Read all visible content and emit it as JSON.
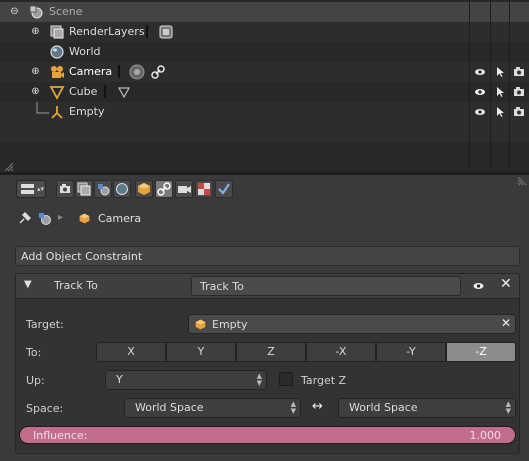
{
  "outliner": {
    "rows": [
      {
        "label": "Scene",
        "icon": "scene-icon"
      },
      {
        "label": "RenderLayers",
        "icon": "render-layers-icon"
      },
      {
        "label": "World",
        "icon": "world-icon"
      },
      {
        "label": "Camera",
        "icon": "camera-object-icon"
      },
      {
        "label": "Cube",
        "icon": "mesh-object-icon"
      },
      {
        "label": "Empty",
        "icon": "empty-object-icon"
      }
    ]
  },
  "properties": {
    "breadcrumb": {
      "object_name": "Camera"
    },
    "add_constraint_label": "Add Object Constraint",
    "constraint": {
      "type_label": "Track To",
      "name_value": "Track To",
      "target_label": "Target:",
      "target_value": "Empty",
      "to_label": "To:",
      "to_axes": [
        "X",
        "Y",
        "Z",
        "-X",
        "-Y",
        "-Z"
      ],
      "to_selected": "-Z",
      "up_label": "Up:",
      "up_value": "Y",
      "target_z_label": "Target Z",
      "target_z_checked": false,
      "space_label": "Space:",
      "owner_space": "World Space",
      "target_space": "World Space",
      "influence_label": "Influence:",
      "influence_value": "1.000",
      "influence_fraction": 1.0
    }
  },
  "colors": {
    "influence_bar": "#c26d8e",
    "active_axis": "#8c8c8c",
    "camera_orange": "#e8a23a"
  }
}
